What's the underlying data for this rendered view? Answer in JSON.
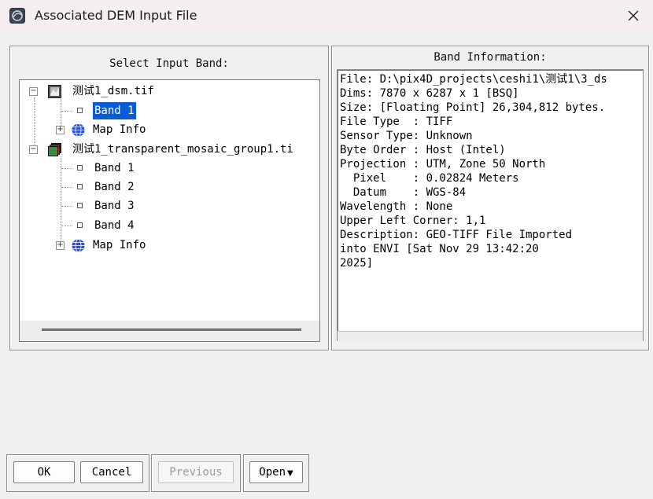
{
  "window": {
    "title": "Associated DEM Input File",
    "icon": "envi-app-icon",
    "close_icon": "close-icon"
  },
  "left_panel": {
    "title": "Select Input Band:",
    "tree": [
      {
        "label": "测试1_dsm.tif",
        "icon": "raster-file-icon"
      },
      {
        "label": "Band 1",
        "selected": true
      },
      {
        "label": "Map Info",
        "icon": "globe-icon"
      },
      {
        "label": "测试1_transparent_mosaic_group1.ti",
        "icon": "rgb-raster-file-icon"
      },
      {
        "label": "Band 1"
      },
      {
        "label": "Band 2"
      },
      {
        "label": "Band 3"
      },
      {
        "label": "Band 4"
      },
      {
        "label": "Map Info",
        "icon": "globe-icon"
      }
    ]
  },
  "right_panel": {
    "title": "Band Information:",
    "lines": [
      "File: D:\\pix4D_projects\\ceshi1\\测试1\\3_ds",
      "Dims: 7870 x 6287 x 1 [BSQ]",
      "Size: [Floating Point] 26,304,812 bytes.",
      "File Type  : TIFF",
      "Sensor Type: Unknown",
      "Byte Order : Host (Intel)",
      "Projection : UTM, Zone 50 North",
      "  Pixel    : 0.02824 Meters",
      "  Datum    : WGS-84",
      "Wavelength : None",
      "Upper Left Corner: 1,1",
      "Description: GEO-TIFF File Imported",
      "into ENVI [Sat Nov 29 13:42:20",
      "2025]"
    ]
  },
  "buttons": {
    "ok": "OK",
    "cancel": "Cancel",
    "previous": "Previous",
    "open": "Open",
    "open_arrow": "▼"
  }
}
